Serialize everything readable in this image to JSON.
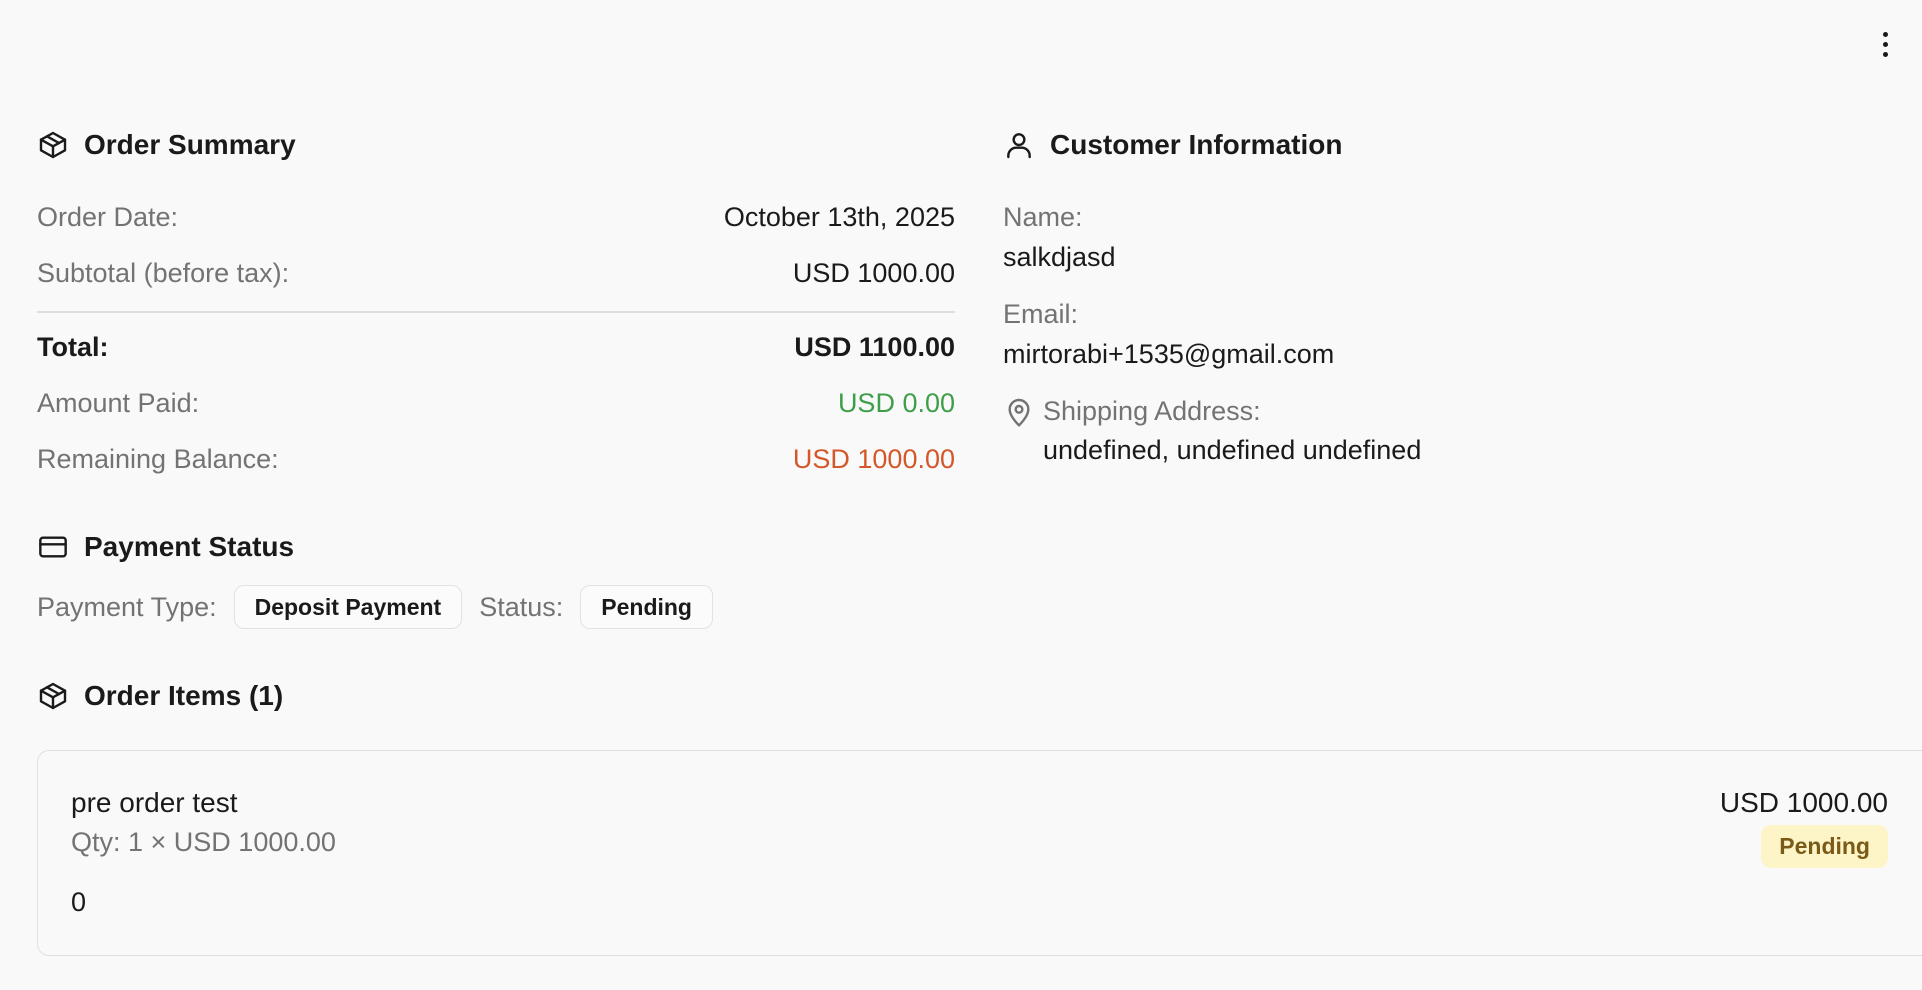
{
  "header": {
    "more_icon": "more-vertical-icon"
  },
  "order_summary": {
    "title": "Order Summary",
    "icon": "package-icon",
    "order_date_label": "Order Date:",
    "order_date_value": "October 13th, 2025",
    "subtotal_label": "Subtotal (before tax):",
    "subtotal_value": "USD 1000.00",
    "total_label": "Total:",
    "total_value": "USD 1100.00",
    "amount_paid_label": "Amount Paid:",
    "amount_paid_value": "USD 0.00",
    "remaining_label": "Remaining Balance:",
    "remaining_value": "USD 1000.00"
  },
  "customer_info": {
    "title": "Customer Information",
    "icon": "user-icon",
    "name_label": "Name:",
    "name_value": "salkdjasd",
    "email_label": "Email:",
    "email_value": "mirtorabi+1535@gmail.com",
    "address_label": "Shipping Address:",
    "address_value": "undefined, undefined undefined",
    "address_icon": "map-pin-icon"
  },
  "payment_status": {
    "title": "Payment Status",
    "icon": "credit-card-icon",
    "payment_type_label": "Payment Type:",
    "payment_type_value": "Deposit Payment",
    "status_label": "Status:",
    "status_value": "Pending"
  },
  "order_items": {
    "title": "Order Items (1)",
    "icon": "package-icon",
    "items": [
      {
        "name": "pre order test",
        "qty_line": "Qty: 1 × USD 1000.00",
        "note": "0",
        "price": "USD 1000.00",
        "status": "Pending"
      }
    ]
  },
  "colors": {
    "paid": "#3f9e4a",
    "remaining": "#d4572a",
    "pending_badge_bg": "#fdf4c8",
    "pending_badge_text": "#7a5a16"
  }
}
